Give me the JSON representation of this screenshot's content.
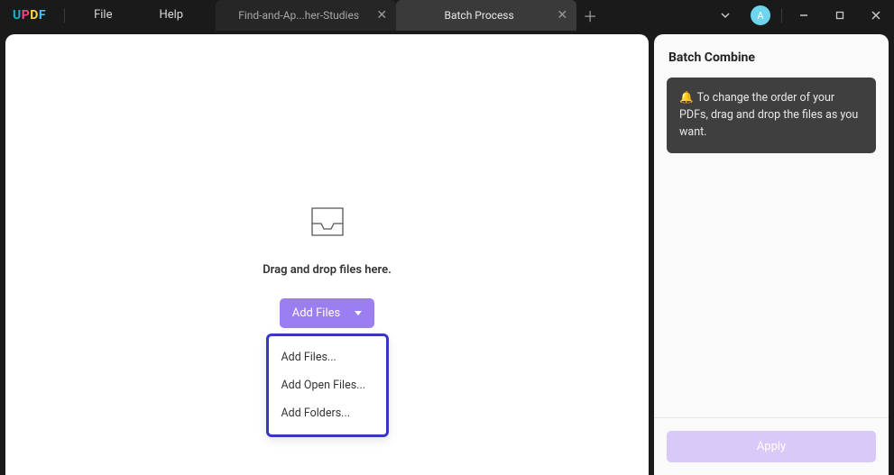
{
  "app": {
    "logo_letters": [
      "U",
      "P",
      "D",
      "F"
    ]
  },
  "menu": {
    "file": "File",
    "help": "Help"
  },
  "tabs": {
    "inactive_label": "Find-and-Ap...her-Studies",
    "active_label": "Batch Process"
  },
  "avatar": {
    "initial": "A"
  },
  "main": {
    "dropzone_text": "Drag and drop files here.",
    "add_files_label": "Add Files",
    "dropdown": {
      "add_files": "Add Files...",
      "add_open_files": "Add Open Files...",
      "add_folders": "Add Folders..."
    }
  },
  "side": {
    "title": "Batch Combine",
    "tip_text": "To change the order of your PDFs, drag and drop the files as you want.",
    "tip_icon": "🔔",
    "apply_label": "Apply"
  }
}
